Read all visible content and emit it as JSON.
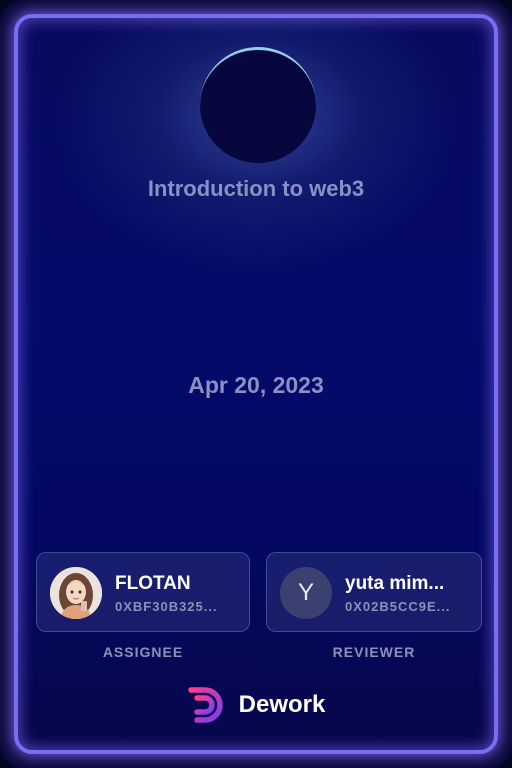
{
  "card": {
    "title": "Introduction to web3",
    "date": "Apr 20, 2023"
  },
  "assignee": {
    "name": "FLOTAN",
    "address": "0XBF30B325...",
    "role": "ASSIGNEE",
    "avatar": "photo"
  },
  "reviewer": {
    "name": "yuta mim...",
    "address": "0X02B5CC9E...",
    "role": "REVIEWER",
    "initial": "Y"
  },
  "brand": {
    "name": "Dework",
    "icon": "dework-logo-icon",
    "colors": [
      "#ff3d8b",
      "#7b3cf5"
    ]
  },
  "colors": {
    "border": "#7b6cf6",
    "background": "#050a6a",
    "muted_text": "#8a8fc4"
  }
}
